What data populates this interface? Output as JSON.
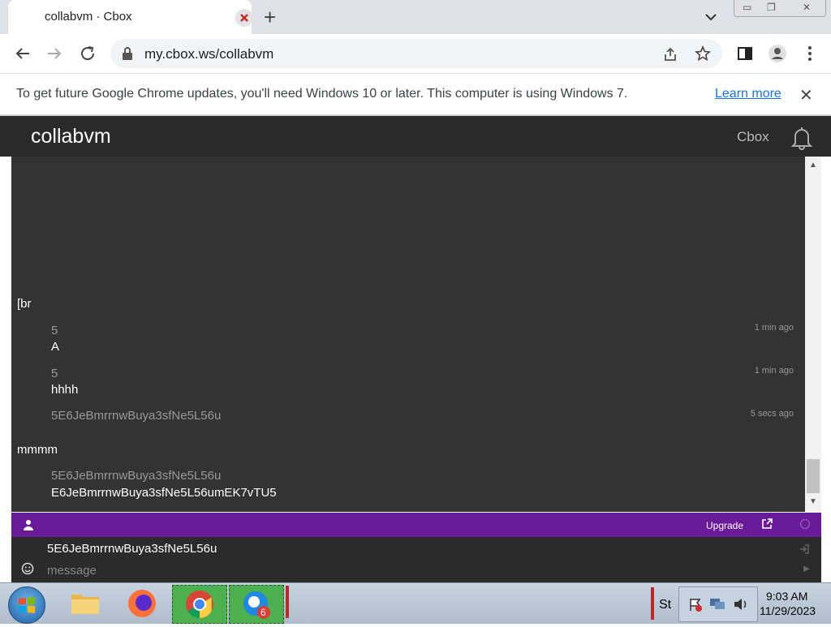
{
  "browser": {
    "tab_title": "collabvm · Cbox",
    "url": "my.cbox.ws/collabvm"
  },
  "infobar": {
    "text": "To get future Google Chrome updates, you'll need Windows 10 or later. This computer is using Windows 7.",
    "link": "Learn more",
    "close": "✕"
  },
  "cbox": {
    "title": "collabvm",
    "brand": "Cbox"
  },
  "messages": [
    {
      "text": "[br"
    },
    {
      "name": "5",
      "text": "A",
      "time": "1 min ago"
    },
    {
      "name": "5",
      "text": "hhhh",
      "time": "1 min ago"
    },
    {
      "name": "5E6JeBmrrnwBuya3sfNe5L56u",
      "text": "",
      "time": "5 secs ago"
    },
    {
      "text": "mmmm"
    },
    {
      "name": "5E6JeBmrrnwBuya3sfNe5L56u",
      "text": "E6JeBmrrnwBuya3sfNe5L56umEK7vTU5",
      "time": ""
    }
  ],
  "bar": {
    "upgrade": "Upgrade"
  },
  "input": {
    "name": "5E6JeBmrrnwBuya3sfNe5L56u",
    "placeholder": "message"
  },
  "taskbar": {
    "time": "9:03 AM",
    "date": "11/29/2023",
    "chat_badge": "6",
    "tray_label": "St"
  },
  "colors": {
    "cbox_bg": "#333333",
    "header_bg": "#2a2a2a",
    "purple": "#6a1b9a",
    "link": "#1a73e8"
  }
}
